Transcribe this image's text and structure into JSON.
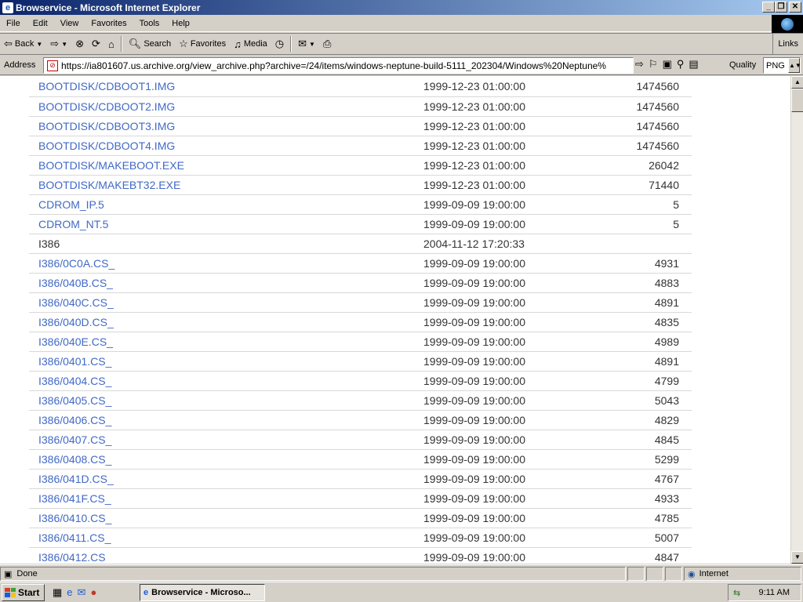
{
  "window": {
    "title": "Browservice - Microsoft Internet Explorer"
  },
  "menu": [
    "File",
    "Edit",
    "View",
    "Favorites",
    "Tools",
    "Help"
  ],
  "toolbar": {
    "back": "Back",
    "search": "Search",
    "favorites": "Favorites",
    "media": "Media",
    "links": "Links"
  },
  "address": {
    "label": "Address",
    "url": "https://ia801607.us.archive.org/view_archive.php?archive=/24/items/windows-neptune-build-5111_202304/Windows%20Neptune%",
    "quality_label": "Quality",
    "quality_value": "PNG"
  },
  "files": [
    {
      "name": "BOOTDISK/CDBOOT1.IMG",
      "date": "1999-12-23 01:00:00",
      "size": "1474560",
      "link": true
    },
    {
      "name": "BOOTDISK/CDBOOT2.IMG",
      "date": "1999-12-23 01:00:00",
      "size": "1474560",
      "link": true
    },
    {
      "name": "BOOTDISK/CDBOOT3.IMG",
      "date": "1999-12-23 01:00:00",
      "size": "1474560",
      "link": true
    },
    {
      "name": "BOOTDISK/CDBOOT4.IMG",
      "date": "1999-12-23 01:00:00",
      "size": "1474560",
      "link": true
    },
    {
      "name": "BOOTDISK/MAKEBOOT.EXE",
      "date": "1999-12-23 01:00:00",
      "size": "26042",
      "link": true
    },
    {
      "name": "BOOTDISK/MAKEBT32.EXE",
      "date": "1999-12-23 01:00:00",
      "size": "71440",
      "link": true
    },
    {
      "name": "CDROM_IP.5",
      "date": "1999-09-09 19:00:00",
      "size": "5",
      "link": true
    },
    {
      "name": "CDROM_NT.5",
      "date": "1999-09-09 19:00:00",
      "size": "5",
      "link": true
    },
    {
      "name": "I386",
      "date": "2004-11-12 17:20:33",
      "size": "",
      "link": false
    },
    {
      "name": "I386/0C0A.CS_",
      "date": "1999-09-09 19:00:00",
      "size": "4931",
      "link": true
    },
    {
      "name": "I386/040B.CS_",
      "date": "1999-09-09 19:00:00",
      "size": "4883",
      "link": true
    },
    {
      "name": "I386/040C.CS_",
      "date": "1999-09-09 19:00:00",
      "size": "4891",
      "link": true
    },
    {
      "name": "I386/040D.CS_",
      "date": "1999-09-09 19:00:00",
      "size": "4835",
      "link": true
    },
    {
      "name": "I386/040E.CS_",
      "date": "1999-09-09 19:00:00",
      "size": "4989",
      "link": true
    },
    {
      "name": "I386/0401.CS_",
      "date": "1999-09-09 19:00:00",
      "size": "4891",
      "link": true
    },
    {
      "name": "I386/0404.CS_",
      "date": "1999-09-09 19:00:00",
      "size": "4799",
      "link": true
    },
    {
      "name": "I386/0405.CS_",
      "date": "1999-09-09 19:00:00",
      "size": "5043",
      "link": true
    },
    {
      "name": "I386/0406.CS_",
      "date": "1999-09-09 19:00:00",
      "size": "4829",
      "link": true
    },
    {
      "name": "I386/0407.CS_",
      "date": "1999-09-09 19:00:00",
      "size": "4845",
      "link": true
    },
    {
      "name": "I386/0408.CS_",
      "date": "1999-09-09 19:00:00",
      "size": "5299",
      "link": true
    },
    {
      "name": "I386/041D.CS_",
      "date": "1999-09-09 19:00:00",
      "size": "4767",
      "link": true
    },
    {
      "name": "I386/041F.CS_",
      "date": "1999-09-09 19:00:00",
      "size": "4933",
      "link": true
    },
    {
      "name": "I386/0410.CS_",
      "date": "1999-09-09 19:00:00",
      "size": "4785",
      "link": true
    },
    {
      "name": "I386/0411.CS_",
      "date": "1999-09-09 19:00:00",
      "size": "5007",
      "link": true
    },
    {
      "name": "I386/0412.CS",
      "date": "1999-09-09 19:00:00",
      "size": "4847",
      "link": true
    }
  ],
  "status": {
    "text": "Done",
    "zone": "Internet"
  },
  "taskbar": {
    "start": "Start",
    "task": "Browservice - Microso...",
    "clock": "9:11 AM"
  },
  "colors": {
    "link": "#4169c6",
    "title_start": "#0a246a",
    "title_end": "#a6caf0",
    "chrome": "#d4d0c8"
  }
}
